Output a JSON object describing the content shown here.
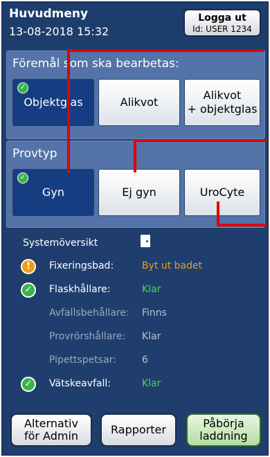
{
  "header": {
    "title": "Huvudmeny",
    "datetime": "13-08-2018 15:32",
    "logout_label": "Logga ut",
    "user_id": "Id: USER 1234"
  },
  "items_panel": {
    "label": "Föremål som ska bearbetas:",
    "options": [
      {
        "label": "Objektglas",
        "selected": true
      },
      {
        "label": "Alikvot",
        "selected": false
      },
      {
        "label": "Alikvot\n+ objektglas",
        "selected": false
      }
    ]
  },
  "sample_panel": {
    "label": "Provtyp",
    "options": [
      {
        "label": "Gyn",
        "selected": true
      },
      {
        "label": "Ej gyn",
        "selected": false
      },
      {
        "label": "UroCyte",
        "selected": false
      }
    ]
  },
  "system": {
    "title": "Systemöversikt",
    "door_icon": "door-icon",
    "rows": [
      {
        "label": "Fixeringsbad:",
        "value": "Byt ut badet",
        "status": "warn",
        "value_color": "#f39c12"
      },
      {
        "label": "Flaskhållare:",
        "value": "Klar",
        "status": "ok",
        "value_color": "#4cd83a"
      },
      {
        "label": "Avfallsbehållare:",
        "value": "Finns",
        "status": "none",
        "value_color": "#b8c3d3"
      },
      {
        "label": "Provrörshållare:",
        "value": "Klar",
        "status": "none",
        "value_color": "#b8c3d3"
      },
      {
        "label": "Pipettspetsar:",
        "value": "6",
        "status": "none",
        "value_color": "#b8c3d3"
      },
      {
        "label": "Vätskeavfall:",
        "value": "Klar",
        "status": "ok",
        "value_color": "#4cd83a"
      }
    ]
  },
  "bottom": {
    "admin_label": "Alternativ\nför Admin",
    "reports_label": "Rapporter",
    "start_label": "Påbörja\nladdning"
  },
  "colors": {
    "background": "#1f3e6e",
    "panel": "#5473a8",
    "selected": "#163c82",
    "annotation": "#e00000"
  }
}
